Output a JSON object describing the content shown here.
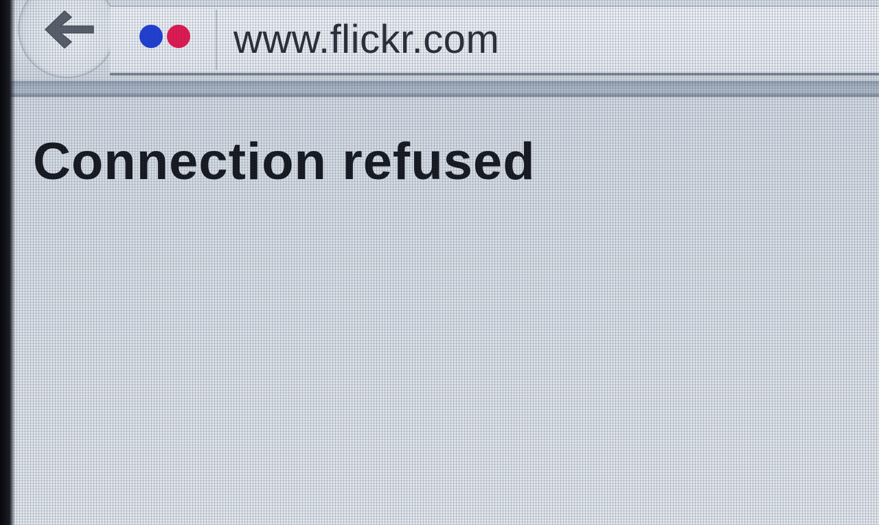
{
  "browser": {
    "back_button": {
      "icon": "arrow-left-icon",
      "label": "Back"
    },
    "address_bar": {
      "site_icon": "flickr-logo-icon",
      "site_icon_colors": {
        "blue": "#1f3fd6",
        "pink": "#e8174f"
      },
      "url": "www.flickr.com"
    }
  },
  "page": {
    "error_title": "Connection refused"
  }
}
